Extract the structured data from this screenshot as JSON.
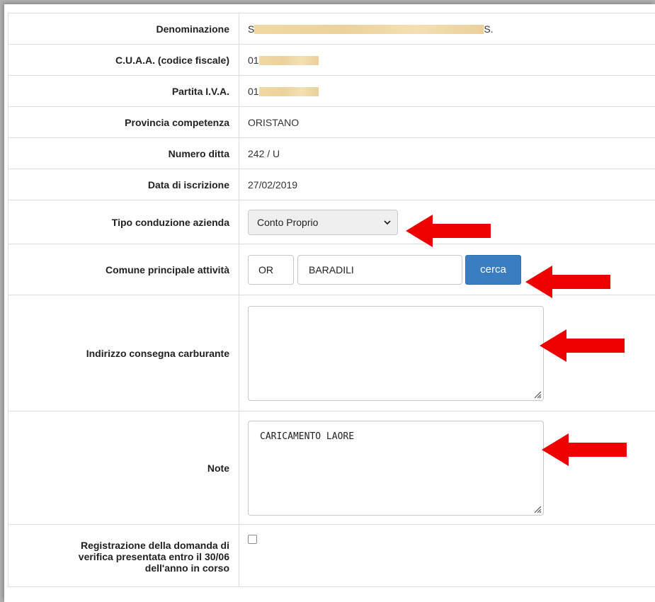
{
  "form": {
    "denominazione": {
      "label": "Denominazione",
      "prefix": "S",
      "suffix": "S."
    },
    "cuaa": {
      "label": "C.U.A.A. (codice fiscale)",
      "prefix": "01"
    },
    "partita_iva": {
      "label": "Partita I.V.A.",
      "prefix": "01"
    },
    "provincia": {
      "label": "Provincia competenza",
      "value": "ORISTANO"
    },
    "numero_ditta": {
      "label": "Numero ditta",
      "value": "242 / U"
    },
    "data_iscrizione": {
      "label": "Data di iscrizione",
      "value": "27/02/2019"
    },
    "tipo_conduzione": {
      "label": "Tipo conduzione azienda",
      "selected": "Conto Proprio"
    },
    "comune": {
      "label": "Comune principale attività",
      "provincia_value": "OR",
      "comune_value": "BARADILI",
      "button_label": "cerca"
    },
    "indirizzo": {
      "label": "Indirizzo consegna carburante",
      "value": ""
    },
    "note": {
      "label": "Note",
      "value": "CARICAMENTO LAORE"
    },
    "registrazione": {
      "label_line1": "Registrazione della domanda di",
      "label_line2": "verifica presentata entro il 30/06",
      "label_line3": "dell'anno in corso",
      "checked": false
    }
  },
  "colors": {
    "arrow": "#ee0000",
    "button": "#3a7dc0",
    "redaction": "#f0d6a0"
  },
  "icons": {
    "select_caret": "chevron-down-icon",
    "resize": "resize-grip-icon",
    "annotation": "red-arrow-icon"
  }
}
